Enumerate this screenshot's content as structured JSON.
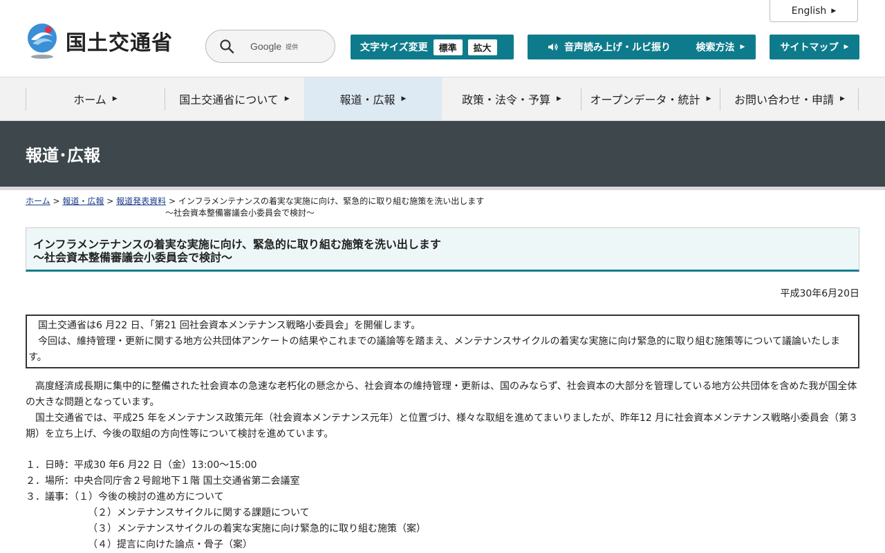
{
  "header": {
    "english_label": "English",
    "logo_text": "国土交通省",
    "search_brand": "Google",
    "search_suffix": "提供",
    "font_size_label": "文字サイズ変更",
    "font_standard": "標準",
    "font_large": "拡大",
    "voice_label": "音声読み上げ・ルビ振り",
    "search_method_label": "検索方法",
    "sitemap_label": "サイトマップ"
  },
  "nav": {
    "items": [
      {
        "label": "ホーム"
      },
      {
        "label": "国土交通省について"
      },
      {
        "label": "報道・広報"
      },
      {
        "label": "政策・法令・予算"
      },
      {
        "label": "オープンデータ・統計"
      },
      {
        "label": "お問い合わせ・申請"
      }
    ]
  },
  "band_title": "報道･広報",
  "breadcrumb": {
    "home": "ホーム",
    "press": "報道・広報",
    "releases": "報道発表資料",
    "current_line1": "インフラメンテナンスの着実な実施に向け、緊急的に取り組む施策を洗い出します",
    "current_line2": "～社会資本整備審議会小委員会で検討～",
    "sep": ">"
  },
  "article": {
    "title_line1": "インフラメンテナンスの着実な実施に向け、緊急的に取り組む施策を洗い出します",
    "title_line2": "～社会資本整備審議会小委員会で検討～",
    "date": "平成30年6月20日",
    "notice_line1": "　国土交通省は6 月22 日、「第21 回社会資本メンテナンス戦略小委員会」を開催します。",
    "notice_line2": "　今回は、維持管理・更新に関する地方公共団体アンケートの結果やこれまでの議論等を踏まえ、メンテナンスサイクルの着実な実施に向け緊急的に取り組む施策等について議論いたします。",
    "para1": "　高度経済成長期に集中的に整備された社会資本の急速な老朽化の懸念から、社会資本の維持管理・更新は、国のみならず、社会資本の大部分を管理している地方公共団体を含めた我が国全体の大きな問題となっています。",
    "para2": "　国土交通省では、平成25 年をメンテナンス政策元年（社会資本メンテナンス元年）と位置づけ、様々な取組を進めてまいりましたが、昨年12 月に社会資本メンテナンス戦略小委員会（第３期）を立ち上げ、今後の取組の方向性等について検討を進めています。",
    "item1": "１．日時：平成30 年6 月22 日（金）13:00～15:00",
    "item2": "２．場所：中央合同庁舎２号館地下１階 国土交通省第二会議室",
    "item3": "３．議事：（１）今後の検討の進め方について",
    "item3_2": "（２）メンテナンスサイクルに関する課題について",
    "item3_3": "（３）メンテナンスサイクルの着実な実施に向け緊急的に取り組む施策（案）",
    "item3_4": "（４）提言に向けた論点・骨子（案）"
  },
  "colors": {
    "accent_teal": "#0e7b8c",
    "band_dark": "#3d474c",
    "nav_active": "#dde9f3"
  }
}
